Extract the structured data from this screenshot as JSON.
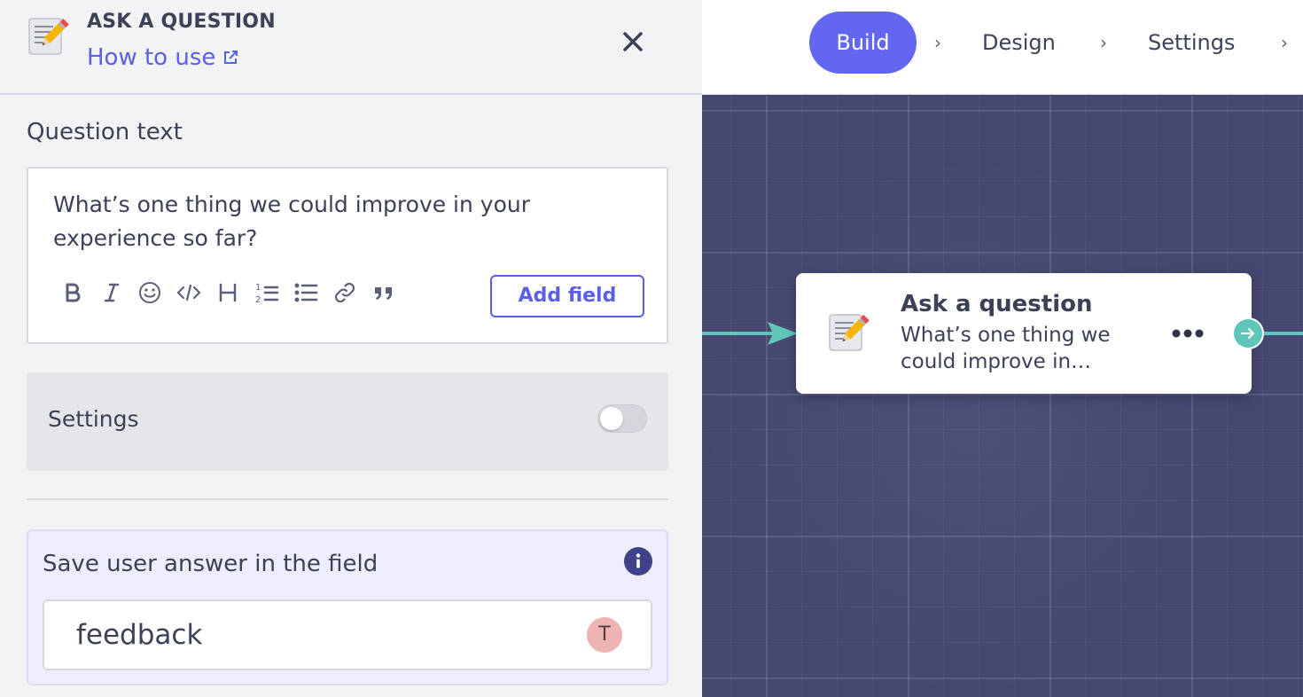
{
  "nav": {
    "steps": [
      {
        "label": "Build",
        "active": true
      },
      {
        "label": "Design",
        "active": false
      },
      {
        "label": "Settings",
        "active": false
      }
    ],
    "accent": "#6366f1"
  },
  "panel": {
    "icon": "memo-pencil-icon",
    "title": "ASK A QUESTION",
    "help_link": "How to use",
    "question_label": "Question text",
    "question_text": "What’s one thing we could improve in your experience so far?",
    "toolbar": [
      "bold-icon",
      "italic-icon",
      "emoji-icon",
      "code-icon",
      "heading-icon",
      "ordered-list-icon",
      "bullet-list-icon",
      "link-icon",
      "quote-icon"
    ],
    "add_field_label": "Add field",
    "settings_label": "Settings",
    "settings_enabled": false,
    "save_label": "Save user answer in the field",
    "field_value": "feedback",
    "field_avatar": "T"
  },
  "node": {
    "title": "Ask a question",
    "description": "What’s one thing we could improve in…",
    "edge_color": "#5fc6b9"
  }
}
